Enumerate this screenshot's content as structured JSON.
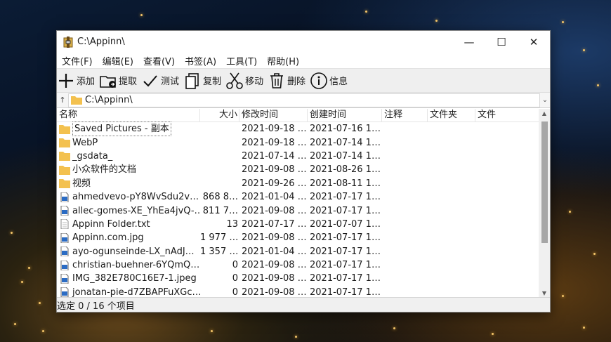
{
  "window": {
    "title": "C:\\Appinn\\"
  },
  "menu": [
    "文件(F)",
    "编辑(E)",
    "查看(V)",
    "书签(A)",
    "工具(T)",
    "帮助(H)"
  ],
  "toolbar": {
    "add": "添加",
    "extract": "提取",
    "test": "测试",
    "copy": "复制",
    "move": "移动",
    "delete": "删除",
    "info": "信息"
  },
  "address": {
    "up": "↑",
    "path": "C:\\Appinn\\"
  },
  "columns": {
    "name": "名称",
    "size": "大小",
    "modified": "修改时间",
    "created": "创建时间",
    "comment": "注释",
    "folders": "文件夹",
    "files": "文件"
  },
  "files": [
    {
      "type": "folder",
      "name": "Saved Pictures - 副本",
      "size": "",
      "modified": "2021-09-18 …",
      "created": "2021-07-16 1…"
    },
    {
      "type": "folder",
      "name": "WebP",
      "size": "",
      "modified": "2021-09-18 …",
      "created": "2021-07-14 1…"
    },
    {
      "type": "folder",
      "name": "_gsdata_",
      "size": "",
      "modified": "2021-07-14 …",
      "created": "2021-07-14 1…"
    },
    {
      "type": "folder",
      "name": "小众软件的文档",
      "size": "",
      "modified": "2021-09-08 …",
      "created": "2021-08-26 1…"
    },
    {
      "type": "folder",
      "name": "视频",
      "size": "",
      "modified": "2021-09-26 …",
      "created": "2021-08-11 1…"
    },
    {
      "type": "image",
      "name": "ahmedvevo-pY8WvSdu2v…",
      "size": "868 8…",
      "modified": "2021-01-04 …",
      "created": "2021-07-17 1…"
    },
    {
      "type": "image",
      "name": "allec-gomes-XE_YhEa4jvQ-…",
      "size": "811 7…",
      "modified": "2021-09-08 …",
      "created": "2021-07-17 1…"
    },
    {
      "type": "text",
      "name": "Appinn Folder.txt",
      "size": "13",
      "modified": "2021-07-17 …",
      "created": "2021-07-07 1…"
    },
    {
      "type": "image",
      "name": "Appinn.com.jpg",
      "size": "1 977 …",
      "modified": "2021-09-08 …",
      "created": "2021-07-17 1…"
    },
    {
      "type": "image",
      "name": "ayo-ogunseinde-LX_nAdJ…",
      "size": "1 357 …",
      "modified": "2021-01-04 …",
      "created": "2021-07-17 1…"
    },
    {
      "type": "image",
      "name": "christian-buehner-6YQmQ…",
      "size": "0",
      "modified": "2021-09-08 …",
      "created": "2021-07-17 1…"
    },
    {
      "type": "image",
      "name": "IMG_382E780C16E7-1.jpeg",
      "size": "0",
      "modified": "2021-09-08 …",
      "created": "2021-07-17 1…"
    },
    {
      "type": "image",
      "name": "jonatan-pie-d7ZBAPFuXGc…",
      "size": "0",
      "modified": "2021-09-08 …",
      "created": "2021-07-17 1…"
    }
  ],
  "status": "选定 0 / 16 个项目",
  "colors": {
    "folder": "#f3c14f",
    "toolbar_bg": "#efefef",
    "scroll_thumb": "#a6a6a6"
  }
}
